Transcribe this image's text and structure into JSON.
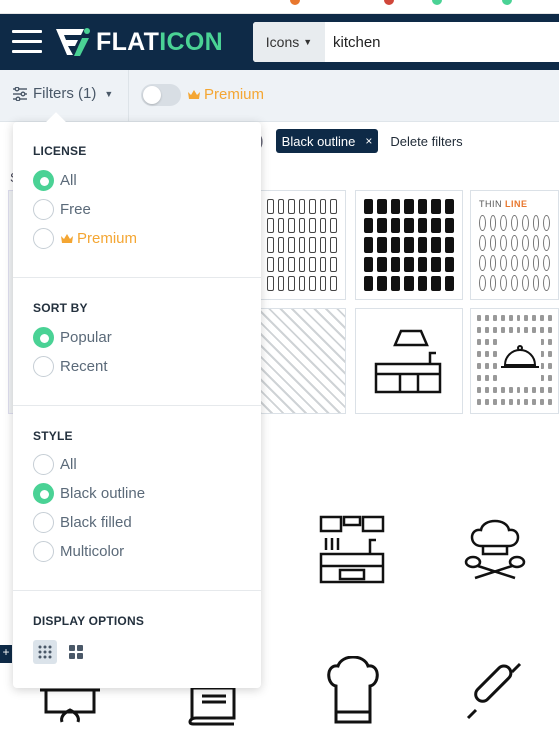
{
  "header": {
    "logo_primary": "FLAT",
    "logo_accent": "ICON",
    "search_type": "Icons",
    "search_value": "kitchen"
  },
  "filterbar": {
    "filters_label": "Filters (1)",
    "premium_label": "Premium",
    "premium_toggle_on": false,
    "active_chip": "Black outline",
    "delete_filters": "Delete filters"
  },
  "dropdown": {
    "license": {
      "title": "LICENSE",
      "options": [
        "All",
        "Free",
        "Premium"
      ],
      "selected": "All"
    },
    "sort_by": {
      "title": "SORT BY",
      "options": [
        "Popular",
        "Recent"
      ],
      "selected": "Popular"
    },
    "style": {
      "title": "STYLE",
      "options": [
        "All",
        "Black outline",
        "Black filled",
        "Multicolor"
      ],
      "selected": "Black outline"
    },
    "display_options": {
      "title": "DISPLAY OPTIONS",
      "selected": "small-grid"
    }
  },
  "thumbnail": {
    "pack_title_a": "THIN ",
    "pack_title_b": "LINE"
  },
  "colors": {
    "navy": "#0e2a47",
    "green": "#4ad295",
    "premium": "#f4a633"
  },
  "icons": [
    "menu-icon",
    "flaticon-logo-icon",
    "caret-down-icon",
    "filter-sliders-icon",
    "crown-icon",
    "close-icon",
    "small-grid-icon",
    "large-grid-icon",
    "kitchen-icon",
    "chef-hat-spoons-icon",
    "pot-icon",
    "cookbook-icon",
    "chef-hat-icon",
    "rolling-pin-icon"
  ]
}
